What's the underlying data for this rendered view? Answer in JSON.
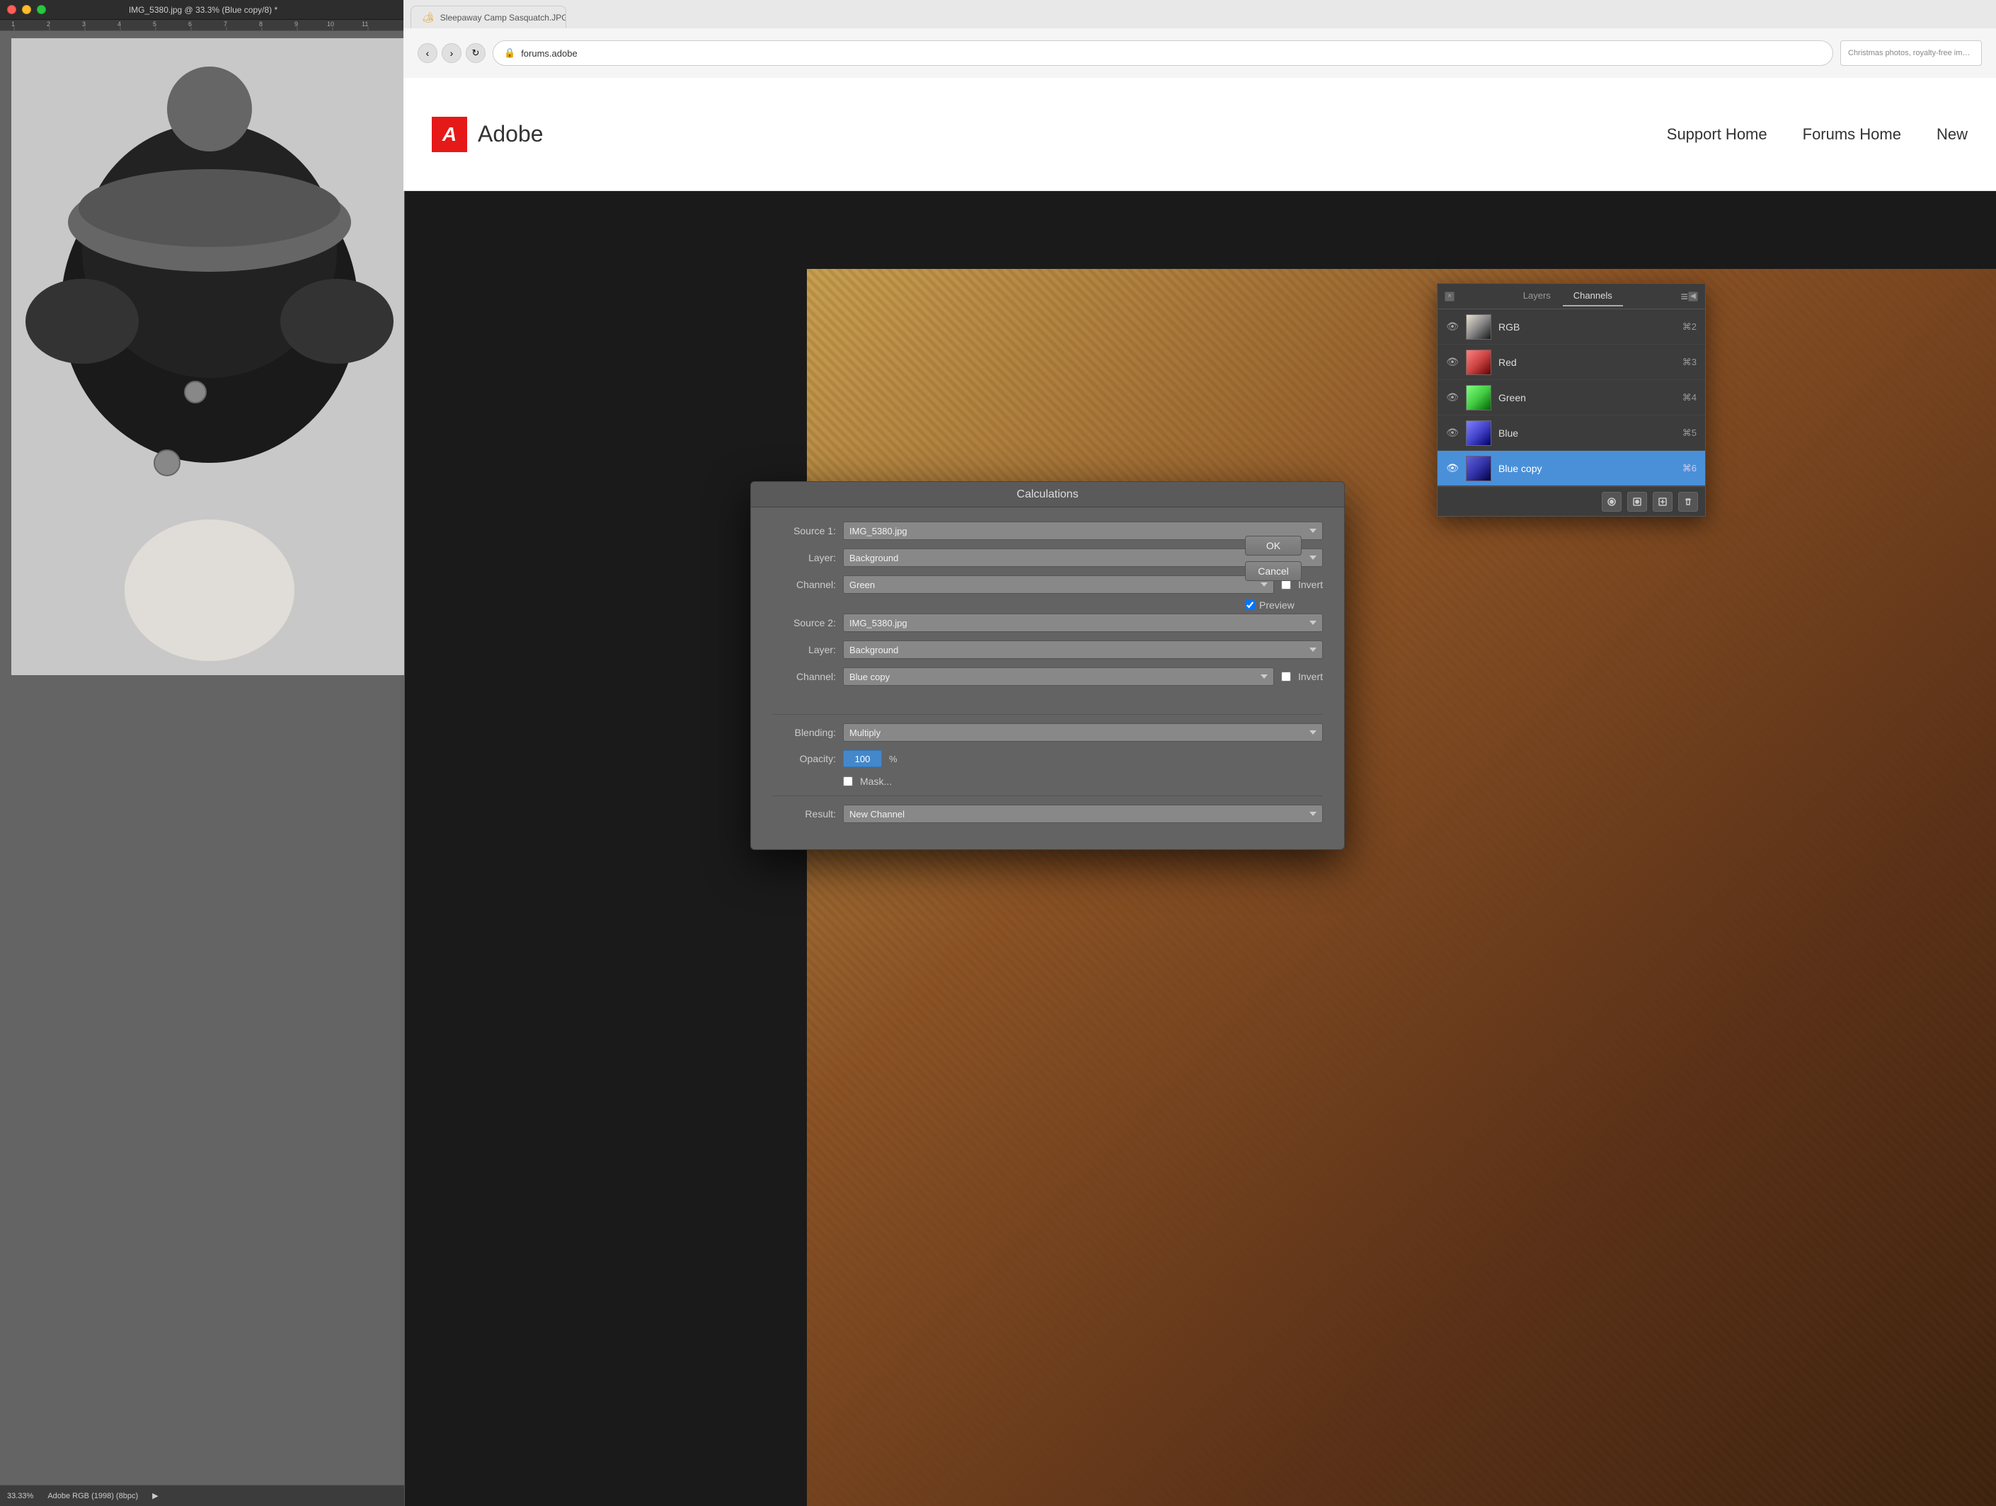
{
  "photoshop": {
    "titlebar": {
      "title": "IMG_5380.jpg @ 33.3% (Blue copy/8) *"
    },
    "statusbar": {
      "zoom": "33.33%",
      "colorProfile": "Adobe RGB (1998) (8bpc)"
    }
  },
  "browser": {
    "tab": {
      "label": "Sleepaway Camp Sasquatch.JPG"
    },
    "url": "forums.adobe",
    "address_text": "forums.adobe",
    "search_bar": "Christmas photos, royalty-free images, graphics, vectors & videos | Adobe Stock",
    "nav": {
      "support_home": "Support Home",
      "forums_home": "Forums Home",
      "new": "New"
    },
    "adobe_logo_letter": "A",
    "adobe_wordmark": "Adobe"
  },
  "calculations_dialog": {
    "title": "Calculations",
    "source1_label": "Source 1:",
    "source1_value": "IMG_5380.jpg",
    "layer_label1": "Layer:",
    "layer_value1": "Background",
    "channel_label1": "Channel:",
    "channel_value1": "Green",
    "invert_label1": "Invert",
    "source2_label": "Source 2:",
    "source2_value": "IMG_5380.jpg",
    "layer_label2": "Layer:",
    "layer_value2": "Background",
    "channel_label2": "Channel:",
    "channel_value2": "Blue copy",
    "invert_label2": "Invert",
    "blending_label": "Blending:",
    "blending_value": "Multiply",
    "opacity_label": "Opacity:",
    "opacity_value": "100",
    "opacity_unit": "%",
    "mask_label": "Mask...",
    "result_label": "Result:",
    "result_value": "New Channel",
    "ok_button": "OK",
    "cancel_button": "Cancel",
    "preview_label": "Preview"
  },
  "channels_panel": {
    "tabs": {
      "layers": "Layers",
      "channels": "Channels"
    },
    "channels": [
      {
        "name": "RGB",
        "shortcut": "⌘2",
        "thumb": "rgb",
        "visible": true
      },
      {
        "name": "Red",
        "shortcut": "⌘3",
        "thumb": "red",
        "visible": true
      },
      {
        "name": "Green",
        "shortcut": "⌘4",
        "thumb": "green",
        "visible": true
      },
      {
        "name": "Blue",
        "shortcut": "⌘5",
        "thumb": "blue",
        "visible": true
      },
      {
        "name": "Blue copy",
        "shortcut": "⌘6",
        "thumb": "bluecopy",
        "visible": true,
        "active": true
      }
    ],
    "footer_buttons": [
      "new-layer-icon",
      "new-channel-icon",
      "delete-icon"
    ]
  },
  "sidebar_search": {
    "placeholder": "Christmas photos, royalty-free images, graphics, vectors & videos | Adobe Stock"
  }
}
